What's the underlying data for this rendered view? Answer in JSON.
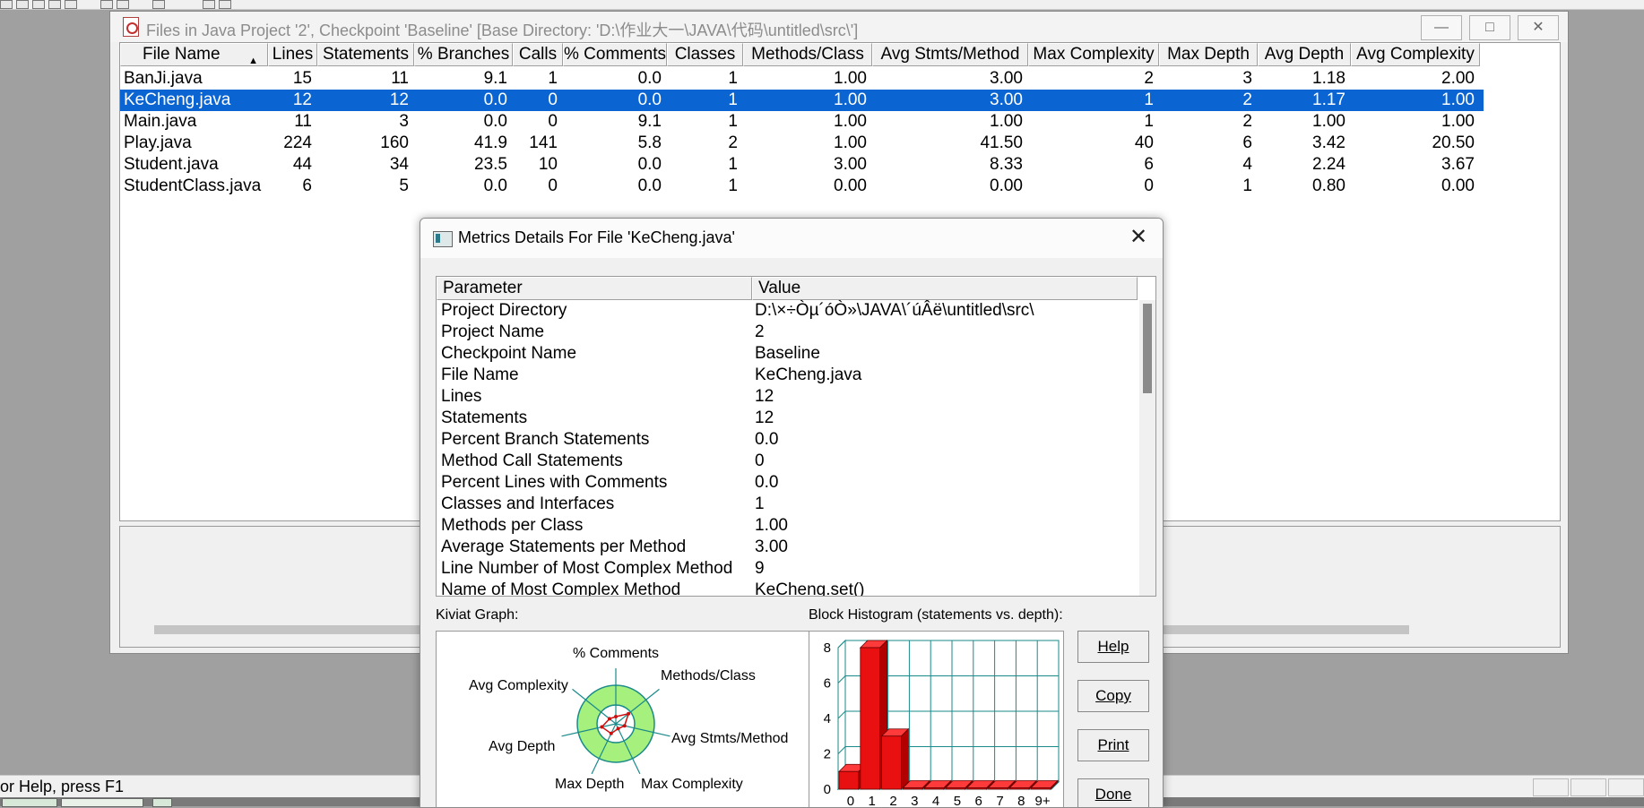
{
  "main_window": {
    "title": "Files in Java Project '2', Checkpoint 'Baseline'  [Base Directory: 'D:\\作业大一\\JAVA\\代码\\untitled\\src\\']",
    "columns": [
      "File Name",
      "Lines",
      "Statements",
      "% Branches",
      "Calls",
      "% Comments",
      "Classes",
      "Methods/Class",
      "Avg Stmts/Method",
      "Max Complexity",
      "Max Depth",
      "Avg Depth",
      "Avg Complexity"
    ],
    "rows": [
      [
        "BanJi.java",
        "15",
        "11",
        "9.1",
        "1",
        "0.0",
        "1",
        "1.00",
        "3.00",
        "2",
        "3",
        "1.18",
        "2.00"
      ],
      [
        "KeCheng.java",
        "12",
        "12",
        "0.0",
        "0",
        "0.0",
        "1",
        "1.00",
        "3.00",
        "1",
        "2",
        "1.17",
        "1.00"
      ],
      [
        "Main.java",
        "11",
        "3",
        "0.0",
        "0",
        "9.1",
        "1",
        "1.00",
        "1.00",
        "1",
        "2",
        "1.00",
        "1.00"
      ],
      [
        "Play.java",
        "224",
        "160",
        "41.9",
        "141",
        "5.8",
        "2",
        "1.00",
        "41.50",
        "40",
        "6",
        "3.42",
        "20.50"
      ],
      [
        "Student.java",
        "44",
        "34",
        "23.5",
        "10",
        "0.0",
        "1",
        "3.00",
        "8.33",
        "6",
        "4",
        "2.24",
        "3.67"
      ],
      [
        "StudentClass.java",
        "6",
        "5",
        "0.0",
        "0",
        "0.0",
        "1",
        "0.00",
        "0.00",
        "0",
        "1",
        "0.80",
        "0.00"
      ]
    ],
    "selected_row": 1
  },
  "status_bar": {
    "text": "or Help, press F1"
  },
  "dialog": {
    "title": "Metrics Details For File 'KeCheng.java'",
    "close_symbol": "✕",
    "param_header": "Parameter",
    "value_header": "Value",
    "params": [
      [
        "Project Directory",
        "D:\\×÷Òµ´óÒ»\\JAVA\\´úÂë\\untitled\\src\\"
      ],
      [
        "Project Name",
        "2"
      ],
      [
        "Checkpoint Name",
        "Baseline"
      ],
      [
        "File Name",
        "KeCheng.java"
      ],
      [
        "Lines",
        "12"
      ],
      [
        "Statements",
        "12"
      ],
      [
        "Percent Branch Statements",
        "0.0"
      ],
      [
        "Method Call Statements",
        "0"
      ],
      [
        "Percent Lines with Comments",
        "0.0"
      ],
      [
        "Classes and Interfaces",
        "1"
      ],
      [
        "Methods per Class",
        "1.00"
      ],
      [
        "Average Statements per Method",
        "3.00"
      ],
      [
        "Line Number of Most Complex Method",
        "9"
      ],
      [
        "Name of Most Complex Method",
        "KeCheng.set()"
      ]
    ],
    "kiviat_label": "Kiviat Graph:",
    "kiviat_axes": [
      "% Comments",
      "Methods/Class",
      "Avg Stmts/Method",
      "Max Complexity",
      "Max Depth",
      "Avg Depth",
      "Avg Complexity"
    ],
    "histogram_label": "Block Histogram (statements vs. depth):",
    "buttons": {
      "help": "Help",
      "copy": "Copy",
      "print": "Print",
      "done": "Done"
    }
  },
  "chart_data": {
    "type": "bar",
    "title": "Block Histogram (statements vs. depth):",
    "categories": [
      "0",
      "1",
      "2",
      "3",
      "4",
      "5",
      "6",
      "7",
      "8",
      "9+"
    ],
    "values": [
      1,
      8,
      3,
      0,
      0,
      0,
      0,
      0,
      0,
      0
    ],
    "yticks": [
      "0",
      "2",
      "4",
      "6",
      "8"
    ],
    "ylim": [
      0,
      8
    ],
    "grid": true,
    "bar_color": "#e81010",
    "grid_color": "#1a8a8a"
  }
}
